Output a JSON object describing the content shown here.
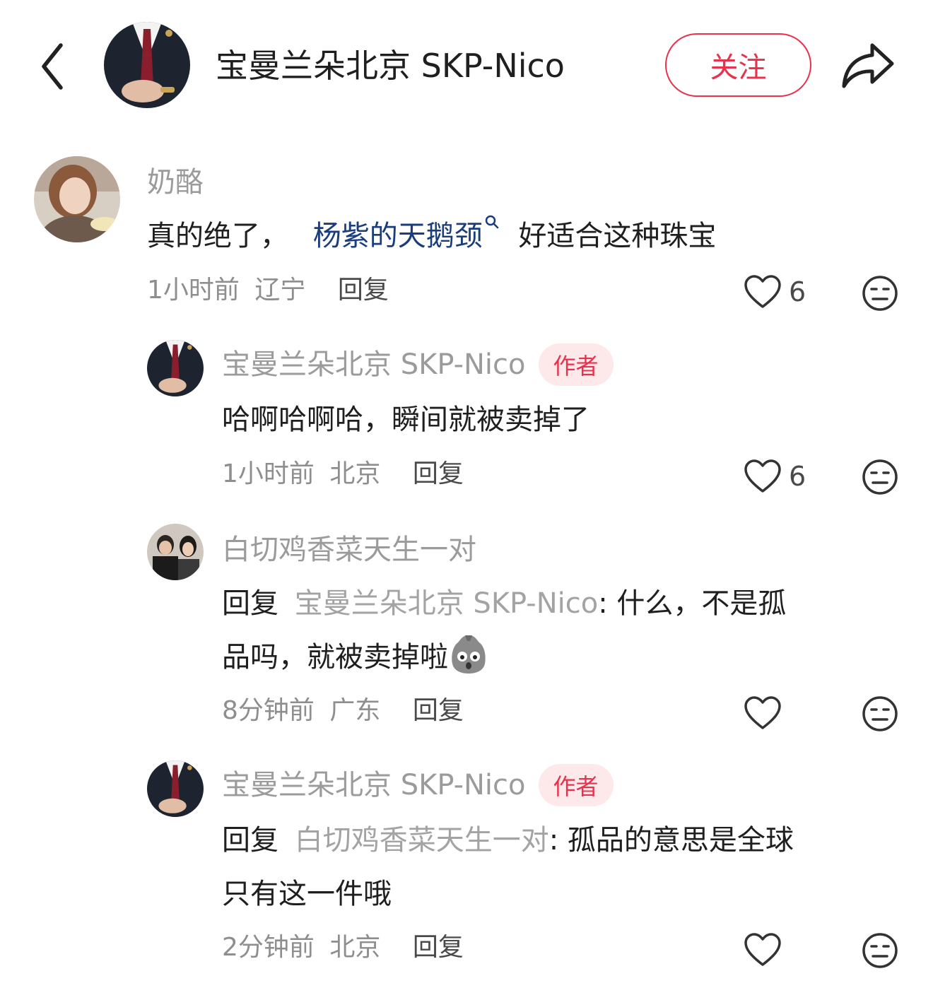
{
  "header": {
    "author_name": "宝曼兰朵北京 SKP-Nico",
    "follow_label": "关注"
  },
  "comments": [
    {
      "user": "奶酪",
      "text_before": "真的绝了，",
      "topic": "杨紫的天鹅颈",
      "text_after": "好适合这种珠宝",
      "time": "1小时前",
      "location": "辽宁",
      "reply_label": "回复",
      "likes": "6"
    },
    {
      "user": "宝曼兰朵北京 SKP-Nico",
      "badge": "作者",
      "text": "哈啊哈啊哈，瞬间就被卖掉了",
      "time": "1小时前",
      "location": "北京",
      "reply_label": "回复",
      "likes": "6"
    },
    {
      "user": "白切鸡香菜天生一对",
      "reply_prefix": "回复",
      "reply_to": "宝曼兰朵北京 SKP-Nico",
      "text_line1": ": 什么，不是孤",
      "text_line2": "品吗，就被卖掉啦",
      "time": "8分钟前",
      "location": "广东",
      "reply_label": "回复"
    },
    {
      "user": "宝曼兰朵北京 SKP-Nico",
      "badge": "作者",
      "reply_prefix": "回复",
      "reply_to": "白切鸡香菜天生一对",
      "text_line1": ": 孤品的意思是全球",
      "text_line2": "只有这一件哦",
      "time": "2分钟前",
      "location": "北京",
      "reply_label": "回复"
    }
  ],
  "icons": {
    "back": "chevron-left-icon",
    "share": "share-arrow-icon",
    "like": "heart-outline-icon",
    "dislike": "meh-face-icon",
    "search": "search-icon",
    "emoji": "shocked-sticker-icon"
  },
  "colors": {
    "accent": "#e8324d",
    "topic": "#1a3d7c",
    "muted": "#9b9b9b"
  }
}
